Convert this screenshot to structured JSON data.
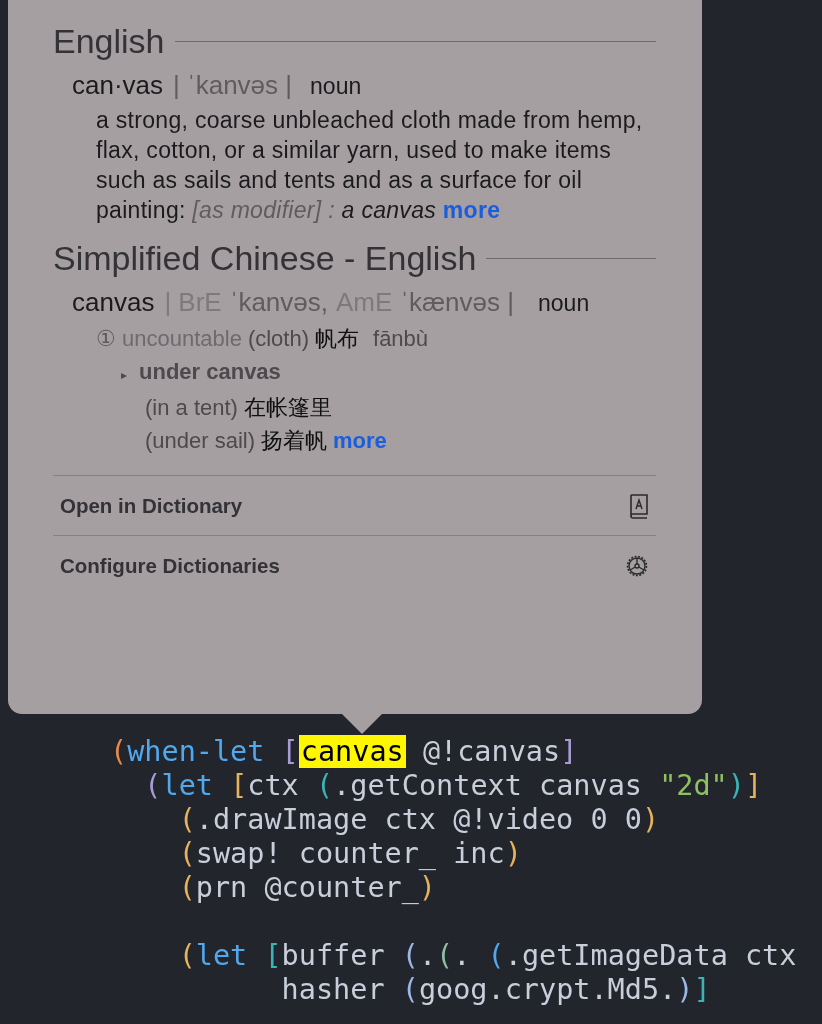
{
  "popover": {
    "english": {
      "title": "English",
      "headword": "can·vas",
      "pronunciation": "| ˈkanvəs |",
      "pos": "noun",
      "definition": "a strong, coarse unbleached cloth made from hemp, flax, cotton, or a similar yarn, used to make items such as sails and tents and as a surface for oil painting:",
      "modifier": "[as modifier] :",
      "example": "a canvas",
      "more": "more"
    },
    "chinese": {
      "title": "Simplified Chinese - English",
      "headword": "canvas",
      "pronunciation": [
        {
          "text": "| BrE",
          "kind": "label"
        },
        {
          "text": "ˈkanvəs,",
          "kind": "ipa"
        },
        {
          "text": "AmE",
          "kind": "label"
        },
        {
          "text": "ˈkænvəs |",
          "kind": "ipa"
        }
      ],
      "pos": "noun",
      "sense": {
        "number": "①",
        "register": "uncountable",
        "gloss": "(cloth)",
        "translation": "帆布",
        "pinyin": "fānbù"
      },
      "phrase": {
        "marker": "▸",
        "text": "under canvas"
      },
      "examples": [
        {
          "gloss": "(in a tent)",
          "translation": "在帐篷里"
        },
        {
          "gloss": "(under sail)",
          "translation": "扬着帆",
          "more": "more"
        }
      ]
    },
    "actions": [
      {
        "label": "Open in Dictionary",
        "kind": "dictionary"
      },
      {
        "label": "Configure Dictionaries",
        "kind": "settings"
      }
    ]
  },
  "code": [
    {
      "tokens": [
        {
          "text": "(",
          "color": "#e5894a"
        },
        {
          "text": "when-let ",
          "color": "#52a8ec"
        },
        {
          "text": "[",
          "color": "#a99ad8"
        },
        {
          "text": "canvas",
          "highlighted": true
        },
        {
          "text": " @!canvas",
          "color": "#c8cfdb"
        },
        {
          "text": "]",
          "color": "#a99ad8"
        }
      ]
    },
    {
      "tokens": [
        {
          "text": "  (",
          "color": "#a99ad8"
        },
        {
          "text": "let ",
          "color": "#52a8ec"
        },
        {
          "text": "[",
          "color": "#e8b15c"
        },
        {
          "text": "ctx ",
          "color": "#c8cfdb"
        },
        {
          "text": "(",
          "color": "#3ab4b4"
        },
        {
          "text": ".getContext canvas ",
          "color": "#c8cfdb"
        },
        {
          "text": "\"2d\"",
          "color": "#8fc163"
        },
        {
          "text": ")",
          "color": "#3ab4b4"
        },
        {
          "text": "]",
          "color": "#e8b15c"
        }
      ]
    },
    {
      "tokens": [
        {
          "text": "    (",
          "color": "#e8b15c"
        },
        {
          "text": ".drawImage ctx @!video 0 0",
          "color": "#c8cfdb"
        },
        {
          "text": ")",
          "color": "#e8b15c"
        }
      ]
    },
    {
      "tokens": [
        {
          "text": "    (",
          "color": "#e8b15c"
        },
        {
          "text": "swap! counter_ inc",
          "color": "#c8cfdb"
        },
        {
          "text": ")",
          "color": "#e8b15c"
        }
      ]
    },
    {
      "tokens": [
        {
          "text": "    (",
          "color": "#e8b15c"
        },
        {
          "text": "prn @counter_",
          "color": "#c8cfdb"
        },
        {
          "text": ")",
          "color": "#e8b15c"
        }
      ]
    },
    {
      "blank_before": true,
      "tokens": [
        {
          "text": "    (",
          "color": "#e8b15c"
        },
        {
          "text": "let ",
          "color": "#52a8ec"
        },
        {
          "text": "[",
          "color": "#3ab4b4"
        },
        {
          "text": "buffer ",
          "color": "#c8cfdb"
        },
        {
          "text": "(",
          "color": "#9db8e6"
        },
        {
          "text": ".",
          "color": "#c8cfdb"
        },
        {
          "text": "(",
          "color": "#8fbfa0"
        },
        {
          "text": ". ",
          "color": "#c8cfdb"
        },
        {
          "text": "(",
          "color": "#52a8ec"
        },
        {
          "text": ".getImageData ctx",
          "color": "#c8cfdb"
        }
      ]
    },
    {
      "tokens": [
        {
          "text": "          hasher ",
          "color": "#c8cfdb"
        },
        {
          "text": "(",
          "color": "#9db8e6"
        },
        {
          "text": "goog.crypt.Md5.",
          "color": "#c8cfdb"
        },
        {
          "text": ")",
          "color": "#9db8e6"
        },
        {
          "text": "]",
          "color": "#3ab4b4"
        }
      ]
    }
  ]
}
